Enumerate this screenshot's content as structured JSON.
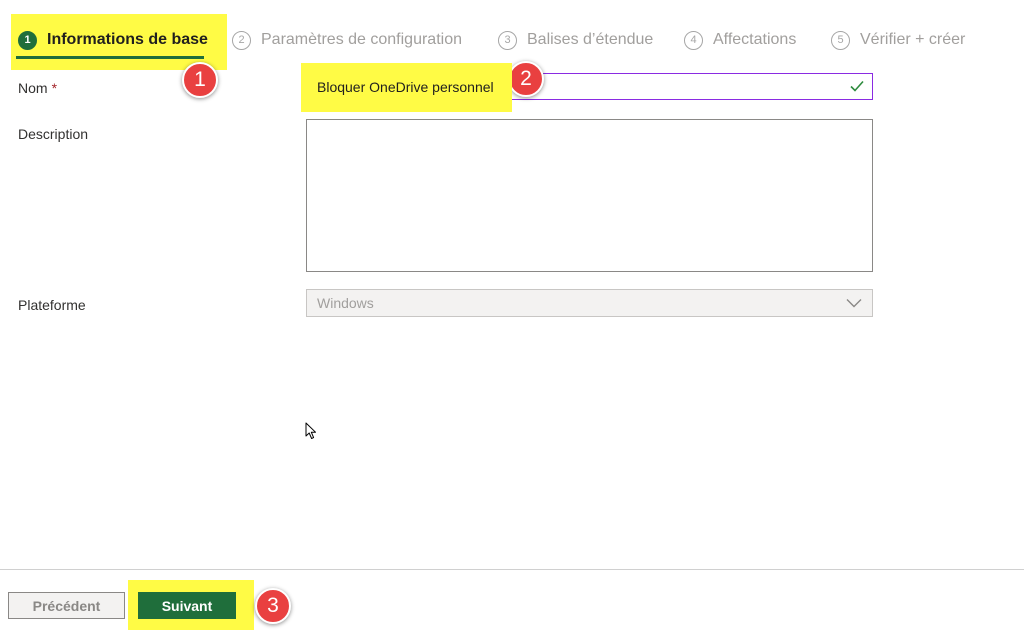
{
  "wizard": {
    "steps": [
      {
        "num": "1",
        "label": "Informations de base"
      },
      {
        "num": "2",
        "label": "Paramètres de configuration"
      },
      {
        "num": "3",
        "label": "Balises d’étendue"
      },
      {
        "num": "4",
        "label": "Affectations"
      },
      {
        "num": "5",
        "label": "Vérifier + créer"
      }
    ]
  },
  "form": {
    "name": {
      "label": "Nom",
      "required_mark": "*",
      "value": "Bloquer OneDrive personnel",
      "valid_icon": "checkmark-icon"
    },
    "description": {
      "label": "Description",
      "value": ""
    },
    "platform": {
      "label": "Plateforme",
      "value": "Windows",
      "icon": "chevron-down-icon"
    }
  },
  "footer": {
    "prev_label": "Précédent",
    "next_label": "Suivant"
  },
  "callouts": [
    "1",
    "2",
    "3"
  ],
  "colors": {
    "accent": "#1f6e3b",
    "highlight": "#fffb45",
    "callout": "#e94040",
    "input_focus": "#8a2be2"
  }
}
